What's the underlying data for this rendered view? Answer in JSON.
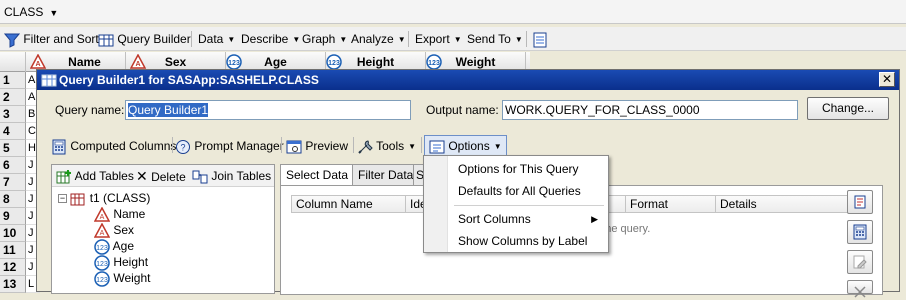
{
  "top_tab": {
    "label": "CLASS"
  },
  "toolbar": {
    "filter_sort": "Filter and Sort",
    "query_builder": "Query Builder",
    "data": "Data",
    "describe": "Describe",
    "graph": "Graph",
    "analyze": "Analyze",
    "export": "Export",
    "send_to": "Send To"
  },
  "grid": {
    "columns": [
      "Name",
      "Sex",
      "Age",
      "Height",
      "Weight"
    ],
    "row_numbers": [
      "1",
      "2",
      "3",
      "4",
      "5",
      "6",
      "7",
      "8",
      "9",
      "10",
      "11",
      "12",
      "13"
    ],
    "first_chars": [
      "A",
      "A",
      "B",
      "C",
      "H",
      "J",
      "J",
      "J",
      "J",
      "J",
      "J",
      "J",
      "L"
    ]
  },
  "dialog": {
    "title": "Query Builder1 for SASApp:SASHELP.CLASS",
    "query_name_label": "Query name:",
    "query_name_value": "Query Builder1",
    "output_name_label": "Output name:",
    "output_name_value": "WORK.QUERY_FOR_CLASS_0000",
    "change_button": "Change...",
    "toolbar": {
      "computed_columns": "Computed Columns",
      "prompt_manager": "Prompt Manager",
      "preview": "Preview",
      "tools": "Tools",
      "options": "Options"
    },
    "left_toolbar": {
      "add_tables": "Add Tables",
      "delete": "Delete",
      "join_tables": "Join Tables"
    },
    "tree": {
      "table": "t1 (CLASS)",
      "columns": [
        "Name",
        "Sex",
        "Age",
        "Height",
        "Weight"
      ]
    },
    "tabs": [
      "Select Data",
      "Filter Data",
      "S"
    ],
    "select_columns": [
      "Column Name",
      "Ide",
      "Format",
      "Details"
    ],
    "empty_hint": "o the query."
  },
  "options_menu": {
    "items": [
      "Options for This Query",
      "Defaults for All Queries",
      "Sort Columns",
      "Show Columns by Label"
    ]
  },
  "colors": {
    "title_bar": "#0a2f8c",
    "dialog_bg": "#ece9d8"
  }
}
